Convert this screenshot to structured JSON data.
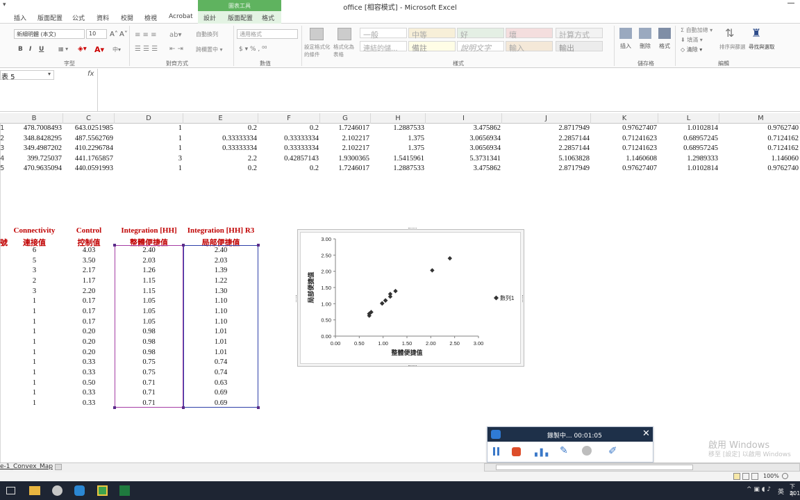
{
  "window": {
    "title": "office [相容模式] - Microsoft Excel",
    "context_group": "圖表工具"
  },
  "tabs": [
    "插入",
    "版面配置",
    "公式",
    "資料",
    "校閱",
    "檢視",
    "Acrobat"
  ],
  "context_tabs": [
    "設計",
    "版面配置",
    "格式"
  ],
  "ribbon": {
    "font_name": "新細明體 (本文)",
    "font_size": "10",
    "bold": "B",
    "italic": "I",
    "underline": "U",
    "wrap_text": "自動換列",
    "merge_center": "跨欄置中",
    "number_format": "通用格式",
    "cond_format": "設定格式化的條件",
    "format_table": "格式化為表格",
    "styles": [
      [
        "一般",
        "中等",
        "好",
        "壞",
        "計算方式"
      ],
      [
        "連結的儲...",
        "備註",
        "說明文字",
        "輸入",
        "輸出"
      ]
    ],
    "insert": "插入",
    "delete": "刪除",
    "format": "格式",
    "autosum": "自動加總",
    "fill": "填滿",
    "clear": "清除",
    "sort_filter": "排序與篩選",
    "find_select": "尋找與選取",
    "groups": {
      "font": "字型",
      "align": "對齊方式",
      "number": "數值",
      "styles": "樣式",
      "cells": "儲存格",
      "edit": "編輯"
    }
  },
  "formula_bar": {
    "name_box": "表 5",
    "fx": "fx"
  },
  "columns": [
    "B",
    "C",
    "D",
    "E",
    "F",
    "G",
    "H",
    "I",
    "J",
    "K",
    "L",
    "M"
  ],
  "data_rows": [
    {
      "rn": "1",
      "cells": [
        "478.7008493",
        "643.0251985",
        "1",
        "0.2",
        "0.2",
        "1.7246017",
        "1.2887533",
        "3.475862",
        "2.8717949",
        "0.97627407",
        "1.0102814",
        "0.9762740"
      ]
    },
    {
      "rn": "2",
      "cells": [
        "348.8428295",
        "487.5562769",
        "1",
        "0.33333334",
        "0.33333334",
        "2.102217",
        "1.375",
        "3.0656934",
        "2.2857144",
        "0.71241623",
        "0.68957245",
        "0.7124162"
      ]
    },
    {
      "rn": "3",
      "cells": [
        "349.4987202",
        "410.2296784",
        "1",
        "0.33333334",
        "0.33333334",
        "2.102217",
        "1.375",
        "3.0656934",
        "2.2857144",
        "0.71241623",
        "0.68957245",
        "0.7124162"
      ]
    },
    {
      "rn": "4",
      "cells": [
        "399.725037",
        "441.1765857",
        "3",
        "2.2",
        "0.42857143",
        "1.9300365",
        "1.5415961",
        "5.3731341",
        "5.1063828",
        "1.1460608",
        "1.2989333",
        "1.146060"
      ]
    },
    {
      "rn": "5",
      "cells": [
        "470.9635094",
        "440.0591993",
        "1",
        "0.2",
        "0.2",
        "1.7246017",
        "1.2887533",
        "3.475862",
        "2.8717949",
        "0.97627407",
        "1.0102814",
        "0.9762740"
      ]
    }
  ],
  "table_headers": {
    "left_fragment": "號",
    "connectivity": [
      "Connectivity",
      "連接值"
    ],
    "control": [
      "Control",
      "控制值"
    ],
    "integration": [
      "Integration [HH]",
      "整體便捷值"
    ],
    "integration_r3": [
      "Integration [HH] R3",
      "局部便捷值"
    ]
  },
  "table_rows": [
    [
      "6",
      "4.03",
      "2.40",
      "2.40"
    ],
    [
      "5",
      "3.50",
      "2.03",
      "2.03"
    ],
    [
      "3",
      "2.17",
      "1.26",
      "1.39"
    ],
    [
      "2",
      "1.17",
      "1.15",
      "1.22"
    ],
    [
      "3",
      "2.20",
      "1.15",
      "1.30"
    ],
    [
      "1",
      "0.17",
      "1.05",
      "1.10"
    ],
    [
      "1",
      "0.17",
      "1.05",
      "1.10"
    ],
    [
      "1",
      "0.17",
      "1.05",
      "1.10"
    ],
    [
      "1",
      "0.20",
      "0.98",
      "1.01"
    ],
    [
      "1",
      "0.20",
      "0.98",
      "1.01"
    ],
    [
      "1",
      "0.20",
      "0.98",
      "1.01"
    ],
    [
      "1",
      "0.33",
      "0.75",
      "0.74"
    ],
    [
      "1",
      "0.33",
      "0.75",
      "0.74"
    ],
    [
      "1",
      "0.50",
      "0.71",
      "0.63"
    ],
    [
      "1",
      "0.33",
      "0.71",
      "0.69"
    ],
    [
      "1",
      "0.33",
      "0.71",
      "0.69"
    ]
  ],
  "chart_data": {
    "type": "scatter",
    "title": "",
    "xlabel": "整體便捷值",
    "ylabel": "局部便捷值",
    "xlim": [
      0,
      3
    ],
    "ylim": [
      0,
      3
    ],
    "x_ticks": [
      "0.00",
      "0.50",
      "1.00",
      "1.50",
      "2.00",
      "2.50",
      "3.00"
    ],
    "y_ticks": [
      "0.00",
      "0.50",
      "1.00",
      "1.50",
      "2.00",
      "2.50",
      "3.00"
    ],
    "legend": "right",
    "marker_color": "#333333",
    "series": [
      {
        "name": "數列1",
        "x": [
          2.4,
          2.03,
          1.26,
          1.15,
          1.15,
          1.05,
          1.05,
          1.05,
          0.98,
          0.98,
          0.98,
          0.75,
          0.75,
          0.71,
          0.71,
          0.71
        ],
        "y": [
          2.4,
          2.03,
          1.39,
          1.22,
          1.3,
          1.1,
          1.1,
          1.1,
          1.01,
          1.01,
          1.01,
          0.74,
          0.74,
          0.63,
          0.69,
          0.69
        ]
      }
    ]
  },
  "sheet_tab": "e-1_Convex_Map",
  "status": {
    "zoom": "100%"
  },
  "recorder": {
    "status": "錄製中... 00:01:05"
  },
  "watermark": {
    "line1": "啟用 Windows",
    "line2": "移至 [設定] 以啟用 Windows"
  },
  "clock": {
    "line1": "下午",
    "line2": "201"
  },
  "ime": "英"
}
